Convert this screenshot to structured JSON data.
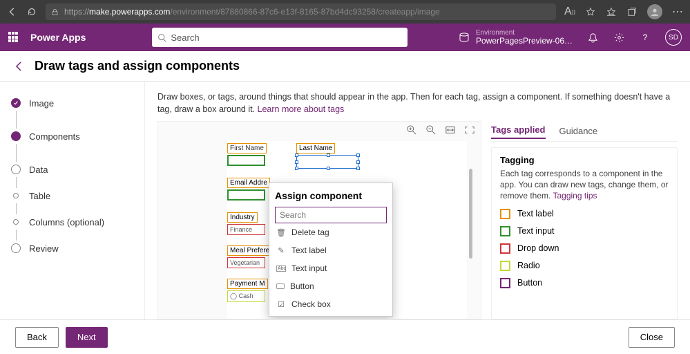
{
  "browser": {
    "url_proto": "https://",
    "url_host": "make.powerapps.com",
    "url_path": "/environment/87880866-87c6-e13f-8165-87bd4dc93258/createapp/image"
  },
  "header": {
    "app_name": "Power Apps",
    "search_placeholder": "Search",
    "env_label": "Environment",
    "env_name": "PowerPagesPreview-06…",
    "user_initials": "SD"
  },
  "page": {
    "title": "Draw tags and assign components"
  },
  "steps": [
    "Image",
    "Components",
    "Data",
    "Table",
    "Columns (optional)",
    "Review"
  ],
  "instructions": {
    "text": "Draw boxes, or tags, around things that should appear in the app. Then for each tag, assign a component. If something doesn't have a tag, draw a box around it. ",
    "link": "Learn more about tags"
  },
  "canvas_tags": {
    "first_name": "First Name",
    "last_name": "Last Name",
    "email": "Email Addre",
    "industry": "Industry",
    "industry_val": "Finance",
    "meal": "Meal Prefere",
    "meal_val": "Vegetarian",
    "payment": "Payment M",
    "payment_val": "Cash"
  },
  "popup": {
    "title": "Assign component",
    "search_placeholder": "Search",
    "options": [
      "Delete tag",
      "Text label",
      "Text input",
      "Button",
      "Check box"
    ]
  },
  "side": {
    "tabs": [
      "Tags applied",
      "Guidance"
    ],
    "card_title": "Tagging",
    "card_text": "Each tag corresponds to a component in the app. You can draw new tags, change them, or remove them. ",
    "card_link": "Tagging tips",
    "legend": [
      {
        "color": "#e69100",
        "label": "Text label"
      },
      {
        "color": "#2f8f2f",
        "label": "Text input"
      },
      {
        "color": "#d13438",
        "label": "Drop down"
      },
      {
        "color": "#c4d93a",
        "label": "Radio"
      },
      {
        "color": "#742774",
        "label": "Button"
      }
    ]
  },
  "footer": {
    "back": "Back",
    "next": "Next",
    "close": "Close"
  }
}
